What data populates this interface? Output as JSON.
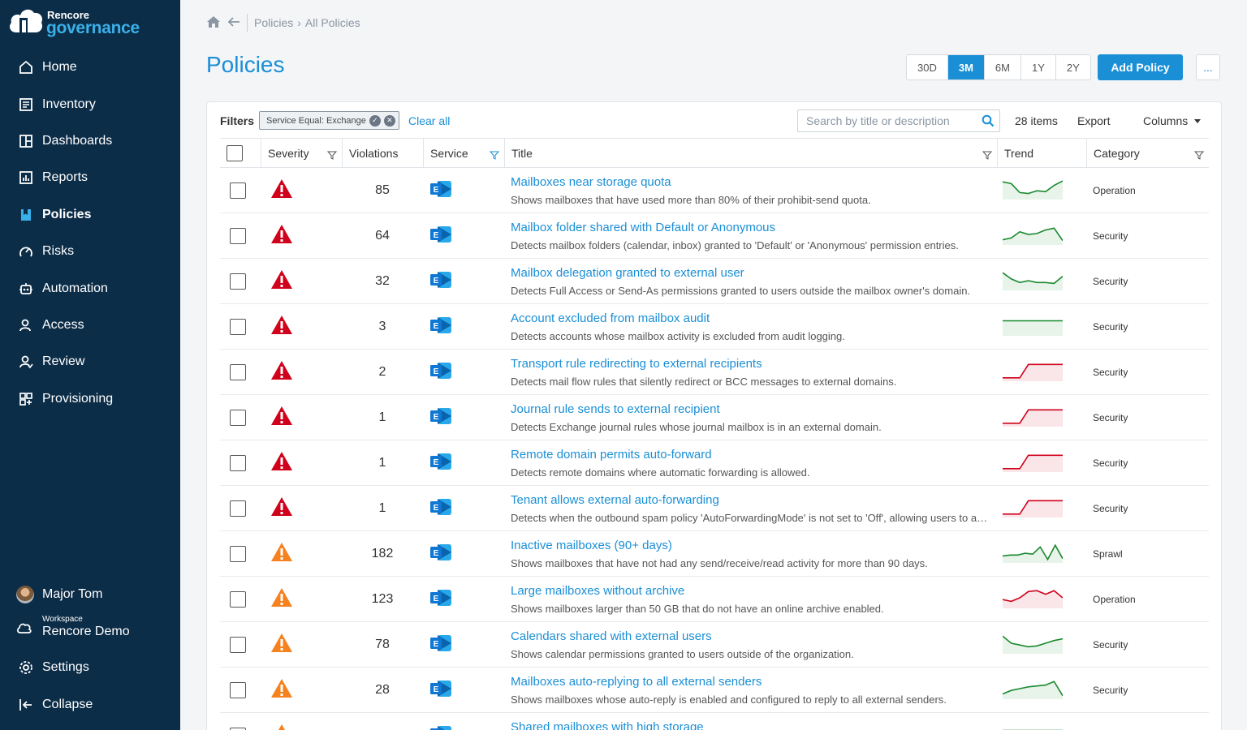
{
  "app": {
    "brand_top": "Rencore",
    "brand_bottom": "governance"
  },
  "nav": [
    {
      "label": "Home",
      "icon": "home-icon"
    },
    {
      "label": "Inventory",
      "icon": "inventory-icon"
    },
    {
      "label": "Dashboards",
      "icon": "dashboards-icon"
    },
    {
      "label": "Reports",
      "icon": "reports-icon"
    },
    {
      "label": "Policies",
      "icon": "policies-icon",
      "active": true
    },
    {
      "label": "Risks",
      "icon": "risks-icon"
    },
    {
      "label": "Automation",
      "icon": "automation-icon"
    },
    {
      "label": "Access",
      "icon": "access-icon"
    },
    {
      "label": "Review",
      "icon": "review-icon"
    },
    {
      "label": "Provisioning",
      "icon": "provisioning-icon"
    }
  ],
  "user": {
    "name": "Major Tom"
  },
  "workspace": {
    "label": "Workspace",
    "name": "Rencore Demo"
  },
  "bottom_nav": {
    "settings": "Settings",
    "collapse": "Collapse"
  },
  "breadcrumb": {
    "items": [
      "Policies",
      "All Policies"
    ],
    "separator": "›"
  },
  "page_title": "Policies",
  "time_ranges": [
    "30D",
    "3M",
    "6M",
    "1Y",
    "2Y"
  ],
  "active_range": "3M",
  "add_policy_label": "Add Policy",
  "more_label": "...",
  "filters": {
    "label": "Filters",
    "chip": "Service Equal: Exchange",
    "clear_all": "Clear all"
  },
  "search": {
    "placeholder": "Search by title or description"
  },
  "items_count": "28 items",
  "export_label": "Export",
  "columns_label": "Columns",
  "table_headers": {
    "severity": "Severity",
    "violations": "Violations",
    "service": "Service",
    "title": "Title",
    "trend": "Trend",
    "category": "Category"
  },
  "colors": {
    "accent": "#1a8fd6",
    "sidebar": "#0c2d48",
    "high": "#d0021b",
    "medium": "#f5821f",
    "trend_green": "#1a8a2e",
    "trend_red": "#d0021b"
  },
  "rows": [
    {
      "severity": "high",
      "violations": "85",
      "title": "Mailboxes near storage quota",
      "description": "Shows mailboxes that have used more than 80% of their prohibit-send quota.",
      "category": "Operation",
      "trend": {
        "color": "green",
        "points": [
          0.9,
          0.8,
          0.3,
          0.25,
          0.4,
          0.35,
          0.7,
          0.95
        ]
      }
    },
    {
      "severity": "high",
      "violations": "64",
      "title": "Mailbox folder shared with Default or Anonymous",
      "description": "Detects mailbox folders (calendar, inbox) granted to 'Default' or 'Anonymous' permission entries.",
      "category": "Security",
      "trend": {
        "color": "green",
        "points": [
          0.2,
          0.3,
          0.65,
          0.5,
          0.55,
          0.75,
          0.85,
          0.15
        ]
      }
    },
    {
      "severity": "high",
      "violations": "32",
      "title": "Mailbox delegation granted to external user",
      "description": "Detects Full Access or Send-As permissions granted to users outside the mailbox owner's domain.",
      "category": "Security",
      "trend": {
        "color": "green",
        "points": [
          0.9,
          0.55,
          0.35,
          0.45,
          0.35,
          0.35,
          0.3,
          0.7
        ]
      }
    },
    {
      "severity": "high",
      "violations": "3",
      "title": "Account excluded from mailbox audit",
      "description": "Detects accounts whose mailbox activity is excluded from audit logging.",
      "category": "Security",
      "trend": {
        "color": "green",
        "points": [
          0.75,
          0.75,
          0.75,
          0.75,
          0.75,
          0.75,
          0.75,
          0.75
        ]
      }
    },
    {
      "severity": "high",
      "violations": "2",
      "title": "Transport rule redirecting to external recipients",
      "description": "Detects mail flow rules that silently redirect or BCC messages to external domains.",
      "category": "Security",
      "trend": {
        "color": "red",
        "points": [
          0.1,
          0.1,
          0.1,
          0.85,
          0.85,
          0.85,
          0.85,
          0.85
        ]
      }
    },
    {
      "severity": "high",
      "violations": "1",
      "title": "Journal rule sends to external recipient",
      "description": "Detects Exchange journal rules whose journal mailbox is in an external domain.",
      "category": "Security",
      "trend": {
        "color": "red",
        "points": [
          0.1,
          0.1,
          0.1,
          0.85,
          0.85,
          0.85,
          0.85,
          0.85
        ]
      }
    },
    {
      "severity": "high",
      "violations": "1",
      "title": "Remote domain permits auto-forward",
      "description": "Detects remote domains where automatic forwarding is allowed.",
      "category": "Security",
      "trend": {
        "color": "red",
        "points": [
          0.1,
          0.1,
          0.1,
          0.85,
          0.85,
          0.85,
          0.85,
          0.85
        ]
      }
    },
    {
      "severity": "high",
      "violations": "1",
      "title": "Tenant allows external auto-forwarding",
      "description": "Detects when the outbound spam policy 'AutoForwardingMode' is not set to 'Off', allowing users to automatically forward mail externally.",
      "category": "Security",
      "trend": {
        "color": "red",
        "points": [
          0.1,
          0.1,
          0.1,
          0.85,
          0.85,
          0.85,
          0.85,
          0.85
        ]
      }
    },
    {
      "severity": "medium",
      "violations": "182",
      "title": "Inactive mailboxes (90+ days)",
      "description": "Shows mailboxes that have not had any send/receive/read activity for more than 90 days.",
      "category": "Sprawl",
      "trend": {
        "color": "green",
        "points": [
          0.3,
          0.35,
          0.35,
          0.45,
          0.4,
          0.8,
          0.1,
          0.9,
          0.15
        ]
      }
    },
    {
      "severity": "medium",
      "violations": "123",
      "title": "Large mailboxes without archive",
      "description": "Shows mailboxes larger than 50 GB that do not have an online archive enabled.",
      "category": "Operation",
      "trend": {
        "color": "red",
        "points": [
          0.4,
          0.3,
          0.5,
          0.85,
          0.9,
          0.7,
          0.9,
          0.5
        ]
      }
    },
    {
      "severity": "medium",
      "violations": "78",
      "title": "Calendars shared with external users",
      "description": "Shows calendar permissions granted to users outside of the organization.",
      "category": "Security",
      "trend": {
        "color": "green",
        "points": [
          0.9,
          0.5,
          0.4,
          0.3,
          0.35,
          0.5,
          0.65,
          0.75
        ]
      }
    },
    {
      "severity": "medium",
      "violations": "28",
      "title": "Mailboxes auto-replying to all external senders",
      "description": "Shows mailboxes whose auto-reply is enabled and configured to reply to all external senders.",
      "category": "Security",
      "trend": {
        "color": "green",
        "points": [
          0.2,
          0.4,
          0.5,
          0.6,
          0.65,
          0.7,
          0.9,
          0.1
        ]
      }
    },
    {
      "severity": "medium",
      "violations": "",
      "title": "Shared mailboxes with high storage",
      "description": "",
      "category": "",
      "trend": {
        "color": "green",
        "points": [
          0.7,
          0.7
        ]
      }
    }
  ]
}
